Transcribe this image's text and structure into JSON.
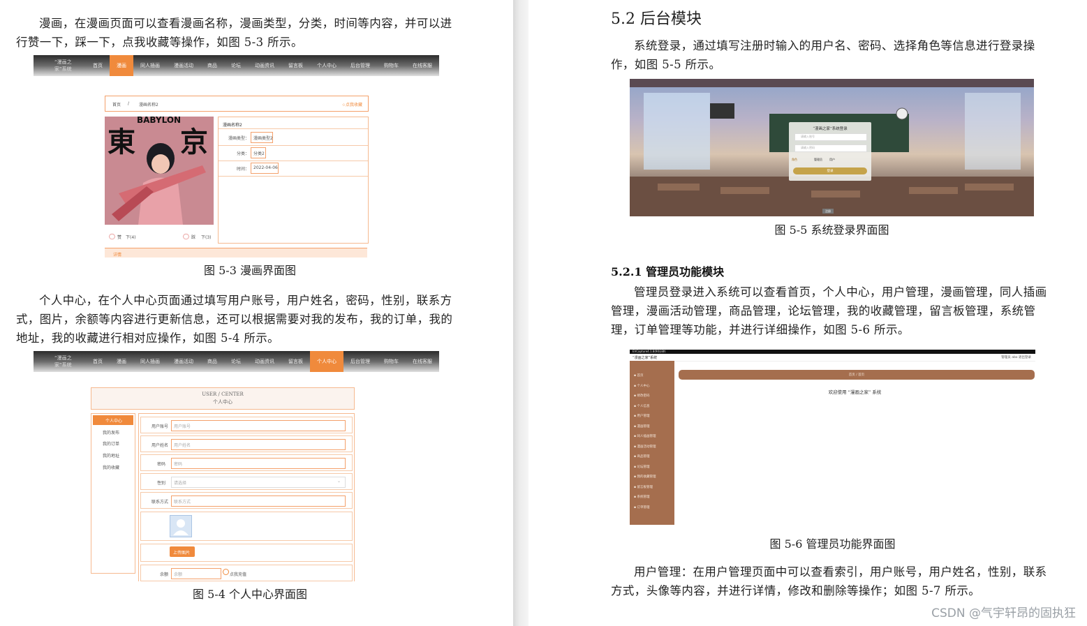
{
  "left_page": {
    "para1": "漫画，在漫画页面可以查看漫画名称，漫画类型，分类，时间等内容，并可以进行赞一下，踩一下，点我收藏等操作，如图 5-3 所示。",
    "fig53_caption": "图 5-3 漫画界面图",
    "para2": "个人中心，在个人中心页面通过填写用户账号，用户姓名，密码，性别，联系方式，图片，余额等内容进行更新信息，还可以根据需要对我的发布，我的订单，我的地址，我的收藏进行相对应操作，如图 5-4 所示。",
    "fig54_caption": "图 5-4 个人中心界面图"
  },
  "nav": {
    "brand": "“漫画之家”系统",
    "items": [
      "首页",
      "漫画",
      "同人插画",
      "漫画活动",
      "商品",
      "论坛",
      "动画资讯",
      "留言板",
      "个人中心",
      "后台管理",
      "购物车",
      "在线客服"
    ]
  },
  "fig53": {
    "breadcrumb_home": "首页",
    "breadcrumb_sep": "/",
    "breadcrumb_current": "漫画名称2",
    "fav_button": "☆点我收藏",
    "title": "漫画名称2",
    "rows": [
      {
        "label": "漫画类型：",
        "value": "漫画类型2"
      },
      {
        "label": "分类：",
        "value": "分类2"
      },
      {
        "label": "时间：",
        "value": "2022-04-06"
      }
    ],
    "cover_text_big1": "東",
    "cover_text_big2": "京",
    "cover_text_small": "BABYLON",
    "like_label": "赞",
    "like_count": "下(4)",
    "dislike_label": "踩",
    "dislike_count": "下(3)",
    "tab_label": "详情"
  },
  "fig54": {
    "header_en": "USER / CENTER",
    "header_cn": "个人中心",
    "menu": [
      "个人中心",
      "我的发布",
      "我的订单",
      "我的地址",
      "我的收藏"
    ],
    "fields": [
      {
        "label": "用户账号",
        "placeholder": "用户账号"
      },
      {
        "label": "用户姓名",
        "placeholder": "用户姓名"
      },
      {
        "label": "密码",
        "placeholder": "密码"
      },
      {
        "label": "性别",
        "placeholder": "请选择"
      },
      {
        "label": "联系方式",
        "placeholder": "联系方式"
      }
    ],
    "upload_button": "上传图片",
    "balance_label": "余额",
    "balance_placeholder": "余额",
    "recharge_label": "点我充值"
  },
  "right_page": {
    "heading": "5.2 后台模块",
    "para1": "系统登录，通过填写注册时输入的用户名、密码、选择角色等信息进行登录操作，如图 5-5 所示。",
    "fig55_caption": "图 5-5 系统登录界面图",
    "subheading": "5.2.1 管理员功能模块",
    "para2": "管理员登录进入系统可以查看首页，个人中心，用户管理，漫画管理，同人插画管理，漫画活动管理，商品管理，论坛管理，我的收藏管理，留言板管理，系统管理，订单管理等功能，并进行详细操作，如图 5-6 所示。",
    "fig56_caption": "图 5-6 管理员功能界面图",
    "para3": "用户管理：在用户管理页面中可以查看索引，用户账号，用户姓名，性别，联系方式，头像等内容，并进行详情，修改和删除等操作；如图 5-7 所示。"
  },
  "fig55": {
    "title": "“漫画之家”系统登录",
    "user_placeholder": "请输入账号",
    "pass_placeholder": "请输入密码",
    "role_label": "角色",
    "role_options": [
      "管理员",
      "用户"
    ],
    "login_button": "登录",
    "register_link": "注册"
  },
  "fig56": {
    "titlebar": "EVCapture4.1.8(90分钟)",
    "brand": "“漫画之家”系统",
    "top_right": "管理员 abo   退出登录",
    "breadcrumb": "首页 / 首页",
    "welcome": "欢迎使用 “漫画之家” 系统",
    "side_items": [
      "首页",
      "个人中心",
      "修改密码",
      "个人信息",
      "用户管理",
      "漫画管理",
      "同人插画管理",
      "漫画活动管理",
      "商品管理",
      "论坛管理",
      "我的收藏管理",
      "留言板管理",
      "系统管理",
      "订单管理"
    ]
  },
  "watermark": "CSDN @气宇轩昂的固执狂"
}
